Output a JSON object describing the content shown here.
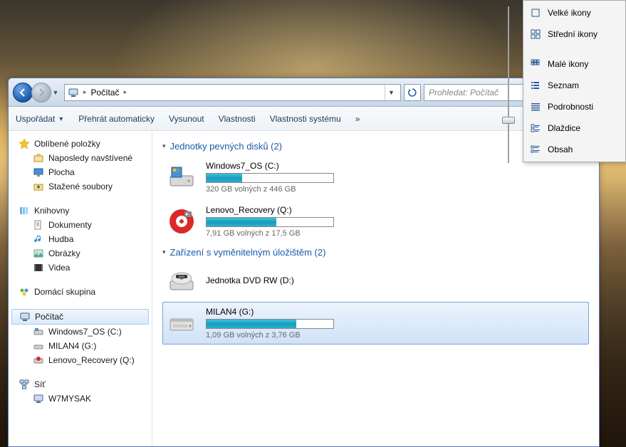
{
  "breadcrumb": {
    "root_icon": "computer",
    "root": "Počítač"
  },
  "search": {
    "placeholder": "Prohledat: Počítač"
  },
  "toolbar": {
    "organize": "Uspořádat",
    "autoplay": "Přehrát automaticky",
    "eject": "Vysunout",
    "properties": "Vlastnosti",
    "sysprops": "Vlastnosti systému",
    "more": "»"
  },
  "sidebar": {
    "favorites": {
      "label": "Oblíbené položky",
      "items": [
        {
          "id": "recent",
          "label": "Naposledy navštívené"
        },
        {
          "id": "desktop",
          "label": "Plocha"
        },
        {
          "id": "downloads",
          "label": "Stažené soubory"
        }
      ]
    },
    "libraries": {
      "label": "Knihovny",
      "items": [
        {
          "id": "documents",
          "label": "Dokumenty"
        },
        {
          "id": "music",
          "label": "Hudba"
        },
        {
          "id": "pictures",
          "label": "Obrázky"
        },
        {
          "id": "videos",
          "label": "Videa"
        }
      ]
    },
    "homegroup": {
      "label": "Domácí skupina"
    },
    "computer": {
      "label": "Počítač",
      "items": [
        {
          "id": "c",
          "label": "Windows7_OS (C:)"
        },
        {
          "id": "g",
          "label": "MILAN4 (G:)"
        },
        {
          "id": "q",
          "label": "Lenovo_Recovery (Q:)"
        }
      ]
    },
    "network": {
      "label": "Síť",
      "items": [
        {
          "id": "w7",
          "label": "W7MYSAK"
        }
      ]
    }
  },
  "content": {
    "hdd_group": "Jednotky pevných disků (2)",
    "removable_group": "Zařízení s vyměnitelným úložištěm (2)",
    "drives": {
      "c": {
        "name": "Windows7_OS (C:)",
        "free": "320 GB volných z 446 GB",
        "pct": 28,
        "color": "blue"
      },
      "q": {
        "name": "Lenovo_Recovery (Q:)",
        "free": "7,91 GB volných z 17,5 GB",
        "pct": 55,
        "color": "blue"
      },
      "d": {
        "name": "Jednotka DVD RW (D:)"
      },
      "g": {
        "name": "MILAN4 (G:)",
        "free": "1,09 GB volných z 3,76 GB",
        "pct": 71,
        "color": "blue"
      }
    }
  },
  "menu": {
    "xlarge": "Velké ikony",
    "large": "Střední ikony",
    "medium": "Malé ikony",
    "list": "Seznam",
    "details": "Podrobnosti",
    "tiles": "Dlaždice",
    "content": "Obsah"
  }
}
